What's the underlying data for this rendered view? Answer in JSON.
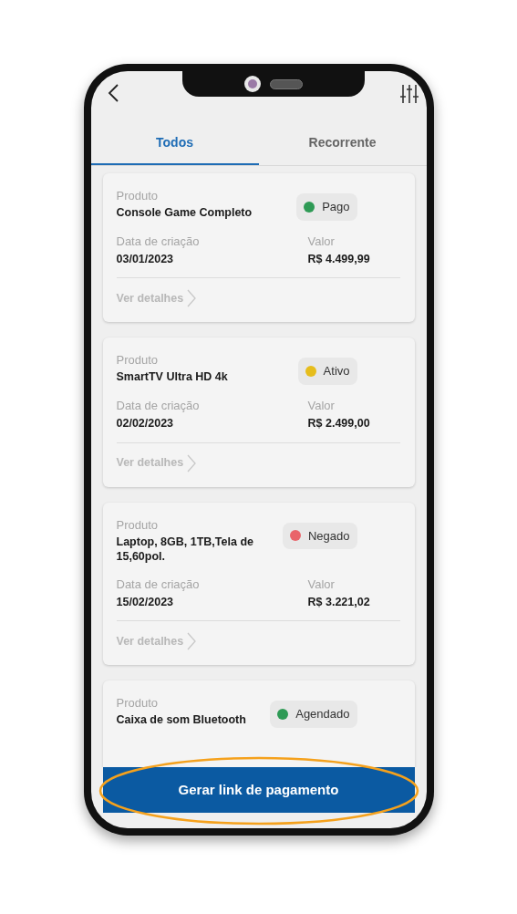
{
  "tabs": [
    {
      "label": "Todos",
      "selected": true
    },
    {
      "label": "Recorrente",
      "selected": false
    }
  ],
  "items": [
    {
      "product_label": "Produto",
      "product": "Console Game Completo",
      "status": "Pago",
      "color": "#2e9a55",
      "date_label": "Data de criação",
      "date": "03/01/2023",
      "value_label": "Valor",
      "value": "R$ 4.499,99",
      "details": "Ver detalhes"
    },
    {
      "product_label": "Produto",
      "product": "SmartTV Ultra HD 4k",
      "status": "Ativo",
      "color": "#e6bd1c",
      "date_label": "Data de criação",
      "date": "02/02/2023",
      "value_label": "Valor",
      "value": "R$ 2.499,00",
      "details": "Ver detalhes"
    },
    {
      "product_label": "Produto",
      "product": "Laptop, 8GB, 1TB,Tela de 15,60pol.",
      "status": "Negado",
      "color": "#e9646a",
      "date_label": "Data de criação",
      "date": "15/02/2023",
      "value_label": "Valor",
      "value": "R$ 3.221,02",
      "details": "Ver detalhes"
    },
    {
      "product_label": "Produto",
      "product": "Caixa de som Bluetooth",
      "status": "Agendado",
      "color": "#2e9a55"
    }
  ],
  "button": "Gerar link de pagamento"
}
